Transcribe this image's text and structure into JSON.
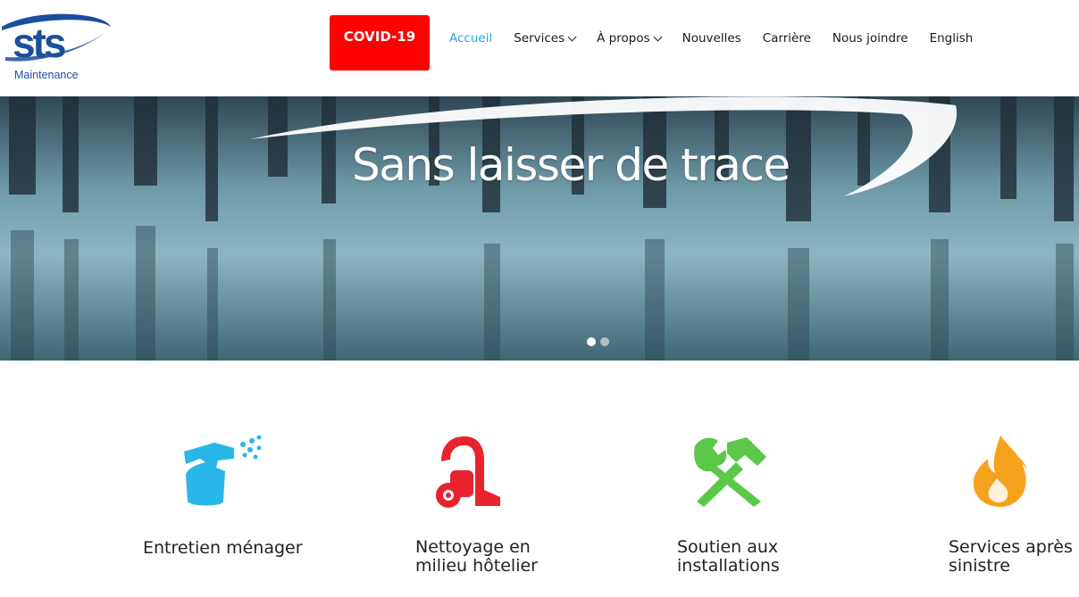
{
  "header": {
    "logo_brand": "sts",
    "logo_subtitle": "Maintenance",
    "covid_label": "COVID-19",
    "nav": [
      {
        "label": "Accueil",
        "active": true,
        "dropdown": false
      },
      {
        "label": "Services",
        "active": false,
        "dropdown": true
      },
      {
        "label": "À propos",
        "active": false,
        "dropdown": true
      },
      {
        "label": "Nouvelles",
        "active": false,
        "dropdown": false
      },
      {
        "label": "Carrière",
        "active": false,
        "dropdown": false
      },
      {
        "label": "Nous joindre",
        "active": false,
        "dropdown": false
      },
      {
        "label": "English",
        "active": false,
        "dropdown": false
      }
    ]
  },
  "hero": {
    "title": "Sans laisser de trace",
    "slides_total": 2,
    "active_slide": 1
  },
  "services": [
    {
      "label_line1": "Entretien ménager",
      "label_line2": "",
      "icon": "spray-bottle-icon",
      "color": "#29b6e8"
    },
    {
      "label_line1": "Nettoyage en",
      "label_line2": "milieu hôtelier",
      "icon": "vacuum-icon",
      "color": "#e8232d"
    },
    {
      "label_line1": "Soutien aux",
      "label_line2": "installations",
      "icon": "tools-icon",
      "color": "#5cc84a"
    },
    {
      "label_line1": "Services après",
      "label_line2": "sinistre",
      "icon": "fire-icon",
      "color": "#f7a21c"
    }
  ],
  "colors": {
    "accent": "#29a8e0",
    "covid_bg": "#ff0000",
    "brand_blue": "#1b4f9c"
  }
}
